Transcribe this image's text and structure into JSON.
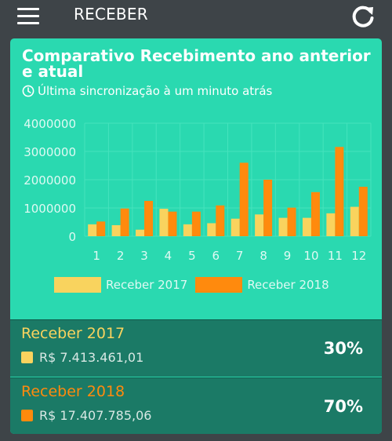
{
  "app": {
    "title": "RECEBER",
    "icons": {
      "menu": "hamburger-menu-icon",
      "refresh": "refresh-icon"
    }
  },
  "card": {
    "title": "Comparativo Recebimento ano anterior e atual",
    "sync_text": "Última sincronização à um minuto atrás",
    "sync_icon": "clock-icon"
  },
  "legend": {
    "series_2017": "Receber 2017",
    "series_2018": "Receber 2018"
  },
  "summary": [
    {
      "name": "Receber 2017",
      "amount": "R$ 7.413.461,01",
      "percent": "30%",
      "color": "#f9d35e"
    },
    {
      "name": "Receber 2018",
      "amount": "R$ 17.407.785,06",
      "percent": "70%",
      "color": "#ff8a0d"
    }
  ],
  "colors": {
    "background": "#3e4448",
    "card": "#2ad9b0",
    "summary_bg": "#1b7a66",
    "series_2017": "#f9d35e",
    "series_2018": "#ff8a0d"
  },
  "chart_data": {
    "type": "bar",
    "categories": [
      "1",
      "2",
      "3",
      "4",
      "5",
      "6",
      "7",
      "8",
      "9",
      "10",
      "11",
      "12"
    ],
    "series": [
      {
        "name": "Receber 2017",
        "color": "#f9d35e",
        "values": [
          420000,
          390000,
          230000,
          970000,
          420000,
          460000,
          620000,
          770000,
          650000,
          650000,
          810000,
          1040000
        ]
      },
      {
        "name": "Receber 2018",
        "color": "#ff8a0d",
        "values": [
          520000,
          980000,
          1250000,
          870000,
          870000,
          1090000,
          2600000,
          2000000,
          1010000,
          1560000,
          3160000,
          1750000
        ]
      }
    ],
    "yticks": [
      "4000000",
      "3000000",
      "2000000",
      "1000000",
      "0"
    ],
    "yticks_values": [
      4000000,
      3000000,
      2000000,
      1000000,
      0
    ],
    "ylim": [
      0,
      4000000
    ],
    "grid": true,
    "legend_position": "bottom"
  }
}
